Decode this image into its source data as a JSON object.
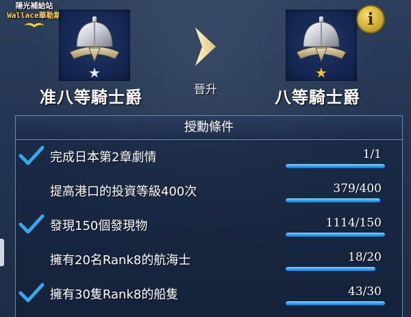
{
  "watermark": {
    "line1": "陽光補給站",
    "line2": "Wallace華勒斯"
  },
  "current_rank": {
    "name": "准八等騎士爵",
    "icon": "helmet-icon",
    "star_color": "#e8eef6"
  },
  "promote_label": "晉升",
  "next_rank": {
    "name": "八等騎士爵",
    "icon": "helmet-icon",
    "star_color": "#f2c234"
  },
  "info_button": {
    "label": "i"
  },
  "conditions": {
    "header": "授勳條件",
    "items": [
      {
        "label": "完成日本第2章劇情",
        "value": "1/1",
        "progress": 1.0,
        "checked": true
      },
      {
        "label": "提高港口的投資等級400次",
        "value": "379/400",
        "progress": 0.95,
        "checked": false
      },
      {
        "label": "發現150個發現物",
        "value": "1114/150",
        "progress": 1.0,
        "checked": true
      },
      {
        "label": "擁有20名Rank8的航海士",
        "value": "18/20",
        "progress": 0.9,
        "checked": false
      },
      {
        "label": "擁有30隻Rank8的船隻",
        "value": "43/30",
        "progress": 1.0,
        "checked": true
      }
    ]
  },
  "colors": {
    "check": "#35a9ec",
    "progress": "#2aa0e8",
    "gold_star": "#f2c234"
  }
}
